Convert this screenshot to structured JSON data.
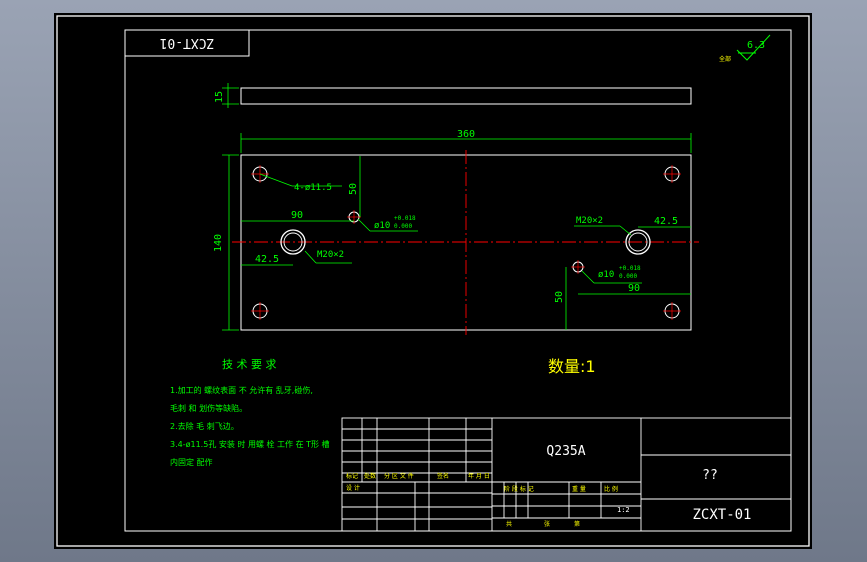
{
  "drawing": {
    "code_rotated": "ZCXT-01",
    "roughness": {
      "value": "6.3",
      "note": "全部"
    },
    "dimensions": {
      "plate_thickness": "15",
      "overall_width": "360",
      "overall_height": "140",
      "hole_spacing_left": "90",
      "hole_spacing_right": "90",
      "edge_offset_left": "42.5",
      "edge_offset_right": "42.5",
      "vertical_offset_left": "50",
      "vertical_offset_right": "50"
    },
    "callouts": {
      "corner_holes": "4-ø11.5",
      "thread_left": "M20×2",
      "thread_right": "M20×2",
      "pin_left": "ø10",
      "pin_right": "ø10",
      "tol_upper": "+0.018",
      "tol_lower": "0.000"
    },
    "tech_requirements": {
      "title": "技 术 要 求",
      "lines": [
        "1.加工的 螺纹表面 不 允许有 乱牙,碰伤,",
        "   毛刺 和 划伤等缺陷。",
        "2.去除 毛 刺飞边。",
        "3.4-ø11.5孔 安装 时 用螺 栓 工作 在 T形 槽",
        "   内固定 配作"
      ]
    },
    "quantity": "数量:1"
  },
  "title_block": {
    "material": "Q235A",
    "name": "??",
    "code": "ZCXT-01",
    "scale": "1:2",
    "labels": {
      "mark": "标记",
      "count": "处数",
      "zone": "分 区 文 件",
      "sign": "签名",
      "date": "年 月 日",
      "design": "设 计",
      "stage": "阶 段 标 记",
      "weight": "重 量",
      "ratio": "比 例",
      "sheet_total": "共",
      "sheet": "张",
      "sheet_no": "第"
    }
  },
  "colors": {
    "background": "#000000",
    "outline": "#ffffff",
    "dimension": "#00ff00",
    "centerline": "#ff0000",
    "text_accent": "#ffff00"
  }
}
